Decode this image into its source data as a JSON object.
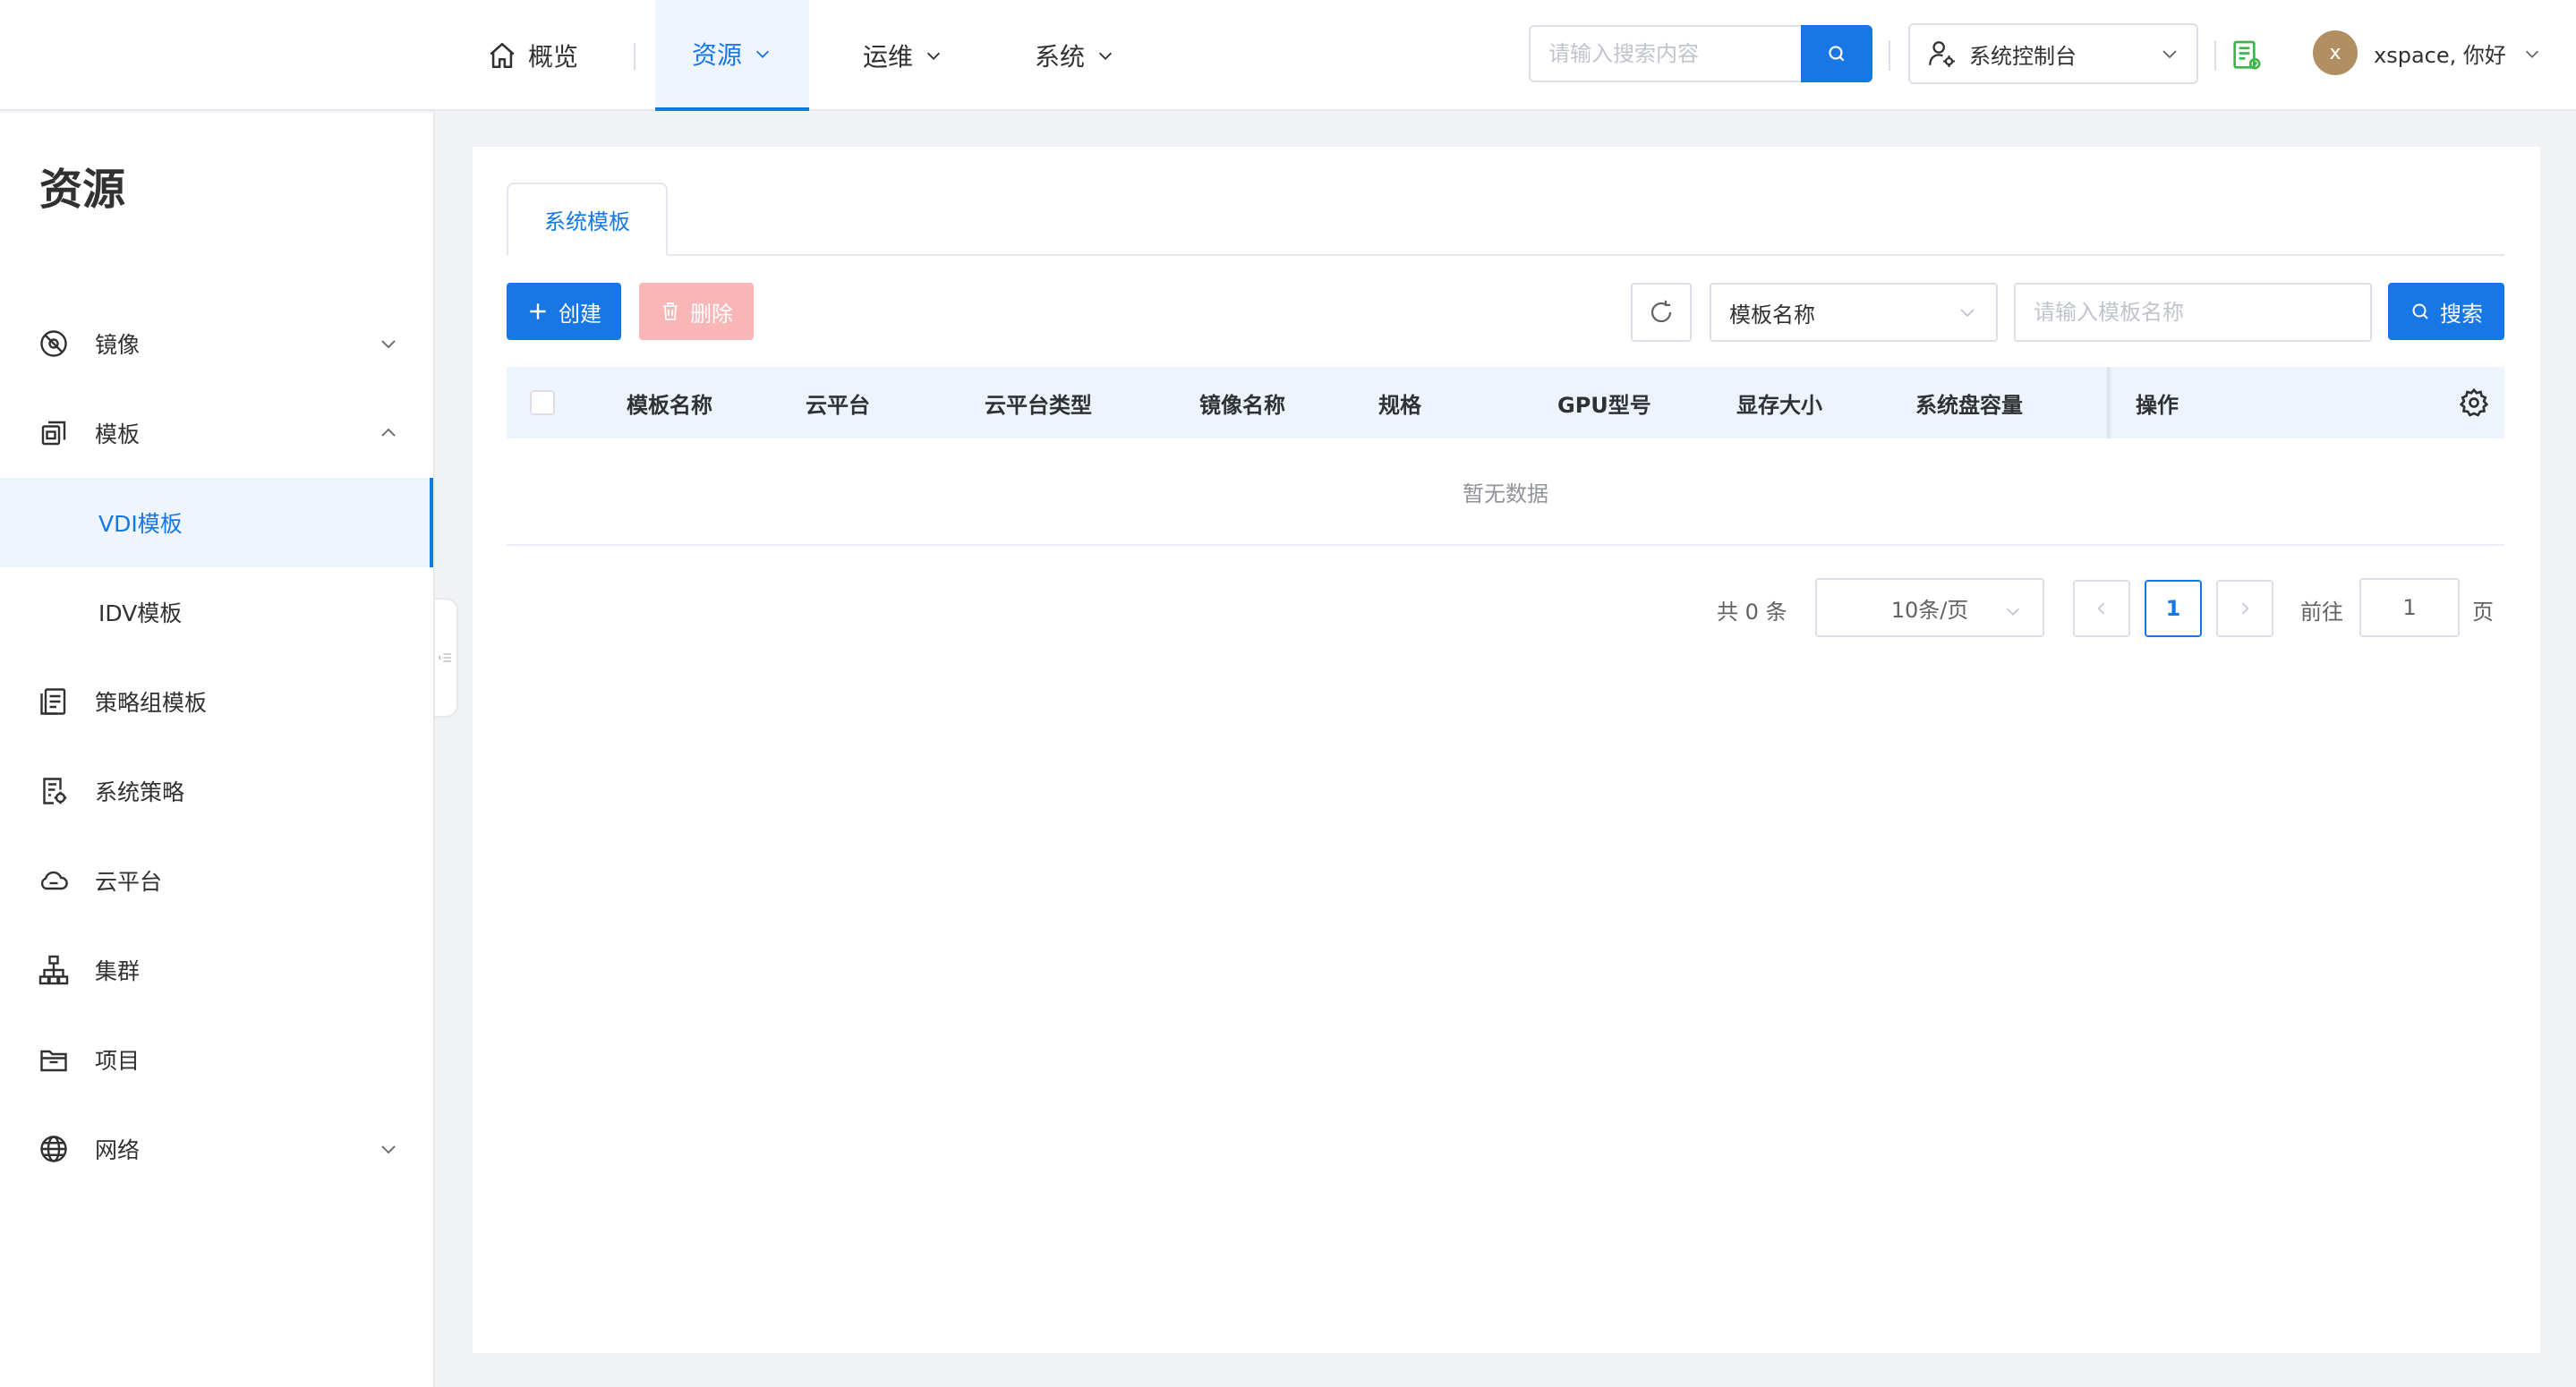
{
  "header": {
    "nav": [
      {
        "label": "概览",
        "icon": "home-icon"
      },
      {
        "label": "资源",
        "active": true
      },
      {
        "label": "运维"
      },
      {
        "label": "系统"
      }
    ],
    "search_placeholder": "请输入搜索内容",
    "console_label": "系统控制台",
    "avatar_letter": "x",
    "greeting": "xspace, 你好"
  },
  "sidebar": {
    "title": "资源",
    "items": [
      {
        "label": "镜像",
        "icon": "image-disc-icon",
        "chevron": "down"
      },
      {
        "label": "模板",
        "icon": "template-icon",
        "chevron": "up"
      },
      {
        "label": "VDI模板",
        "active": true
      },
      {
        "label": "IDV模板"
      },
      {
        "label": "策略组模板",
        "icon": "policy-group-icon"
      },
      {
        "label": "系统策略",
        "icon": "system-policy-icon"
      },
      {
        "label": "云平台",
        "icon": "cloud-icon"
      },
      {
        "label": "集群",
        "icon": "cluster-icon"
      },
      {
        "label": "项目",
        "icon": "folder-icon"
      },
      {
        "label": "网络",
        "icon": "globe-icon",
        "chevron": "down"
      }
    ]
  },
  "main": {
    "tab": "系统模板",
    "create_label": "创建",
    "delete_label": "删除",
    "filter_field": "模板名称",
    "keyword_placeholder": "请输入模板名称",
    "search_label": "搜索",
    "columns": [
      "模板名称",
      "云平台",
      "云平台类型",
      "镜像名称",
      "规格",
      "GPU型号",
      "显存大小",
      "系统盘容量",
      "操作"
    ],
    "empty_text": "暂无数据",
    "pagination": {
      "total": "共 0 条",
      "page_size": "10条/页",
      "current_page": "1",
      "goto_label": "前往",
      "goto_value": "1",
      "page_suffix": "页"
    }
  },
  "colors": {
    "primary": "#1677e5",
    "danger_disabled": "#fab6b6",
    "header_bg": "#eef4fd",
    "avatar": "#b09060"
  }
}
